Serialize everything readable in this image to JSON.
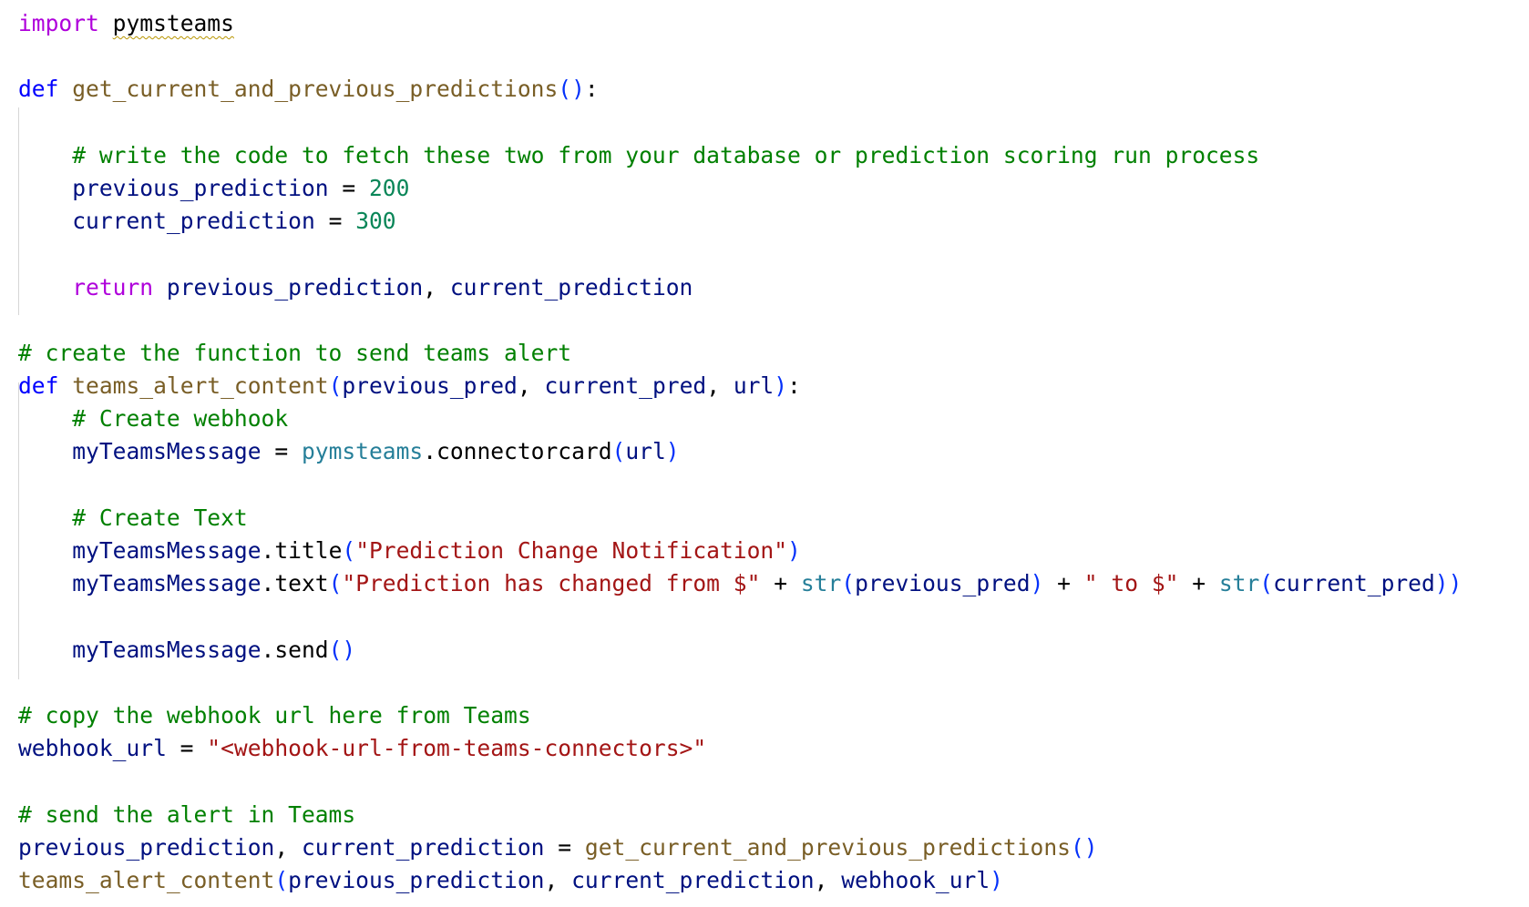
{
  "editor": {
    "language": "python",
    "lines": [
      [
        {
          "t": "import",
          "c": "keyword"
        },
        {
          "t": " ",
          "c": "plain"
        },
        {
          "t": "pymsteams",
          "c": "plain",
          "squiggle": true
        }
      ],
      [],
      [
        {
          "t": "def",
          "c": "def"
        },
        {
          "t": " ",
          "c": "plain"
        },
        {
          "t": "get_current_and_previous_predictions",
          "c": "func"
        },
        {
          "t": "()",
          "c": "paren"
        },
        {
          "t": ":",
          "c": "plain"
        }
      ],
      [],
      [
        {
          "t": "    ",
          "c": "plain"
        },
        {
          "t": "# write the code to fetch these two from your database or prediction scoring run process",
          "c": "comment"
        }
      ],
      [
        {
          "t": "    ",
          "c": "plain"
        },
        {
          "t": "previous_prediction",
          "c": "var"
        },
        {
          "t": " = ",
          "c": "plain"
        },
        {
          "t": "200",
          "c": "number"
        }
      ],
      [
        {
          "t": "    ",
          "c": "plain"
        },
        {
          "t": "current_prediction",
          "c": "var"
        },
        {
          "t": " = ",
          "c": "plain"
        },
        {
          "t": "300",
          "c": "number"
        }
      ],
      [],
      [
        {
          "t": "    ",
          "c": "plain"
        },
        {
          "t": "return",
          "c": "keyword"
        },
        {
          "t": " ",
          "c": "plain"
        },
        {
          "t": "previous_prediction",
          "c": "var"
        },
        {
          "t": ", ",
          "c": "plain"
        },
        {
          "t": "current_prediction",
          "c": "var"
        }
      ],
      [],
      [
        {
          "t": "# create the function to send teams alert",
          "c": "comment"
        }
      ],
      [
        {
          "t": "def",
          "c": "def"
        },
        {
          "t": " ",
          "c": "plain"
        },
        {
          "t": "teams_alert_content",
          "c": "func"
        },
        {
          "t": "(",
          "c": "paren"
        },
        {
          "t": "previous_pred",
          "c": "var"
        },
        {
          "t": ", ",
          "c": "plain"
        },
        {
          "t": "current_pred",
          "c": "var"
        },
        {
          "t": ", ",
          "c": "plain"
        },
        {
          "t": "url",
          "c": "var"
        },
        {
          "t": ")",
          "c": "paren"
        },
        {
          "t": ":",
          "c": "plain"
        }
      ],
      [
        {
          "t": "    ",
          "c": "plain"
        },
        {
          "t": "# Create webhook",
          "c": "comment"
        }
      ],
      [
        {
          "t": "    ",
          "c": "plain"
        },
        {
          "t": "myTeamsMessage",
          "c": "var"
        },
        {
          "t": " = ",
          "c": "plain"
        },
        {
          "t": "pymsteams",
          "c": "module"
        },
        {
          "t": ".connectorcard",
          "c": "plain"
        },
        {
          "t": "(",
          "c": "paren"
        },
        {
          "t": "url",
          "c": "var"
        },
        {
          "t": ")",
          "c": "paren"
        }
      ],
      [],
      [
        {
          "t": "    ",
          "c": "plain"
        },
        {
          "t": "# Create Text",
          "c": "comment"
        }
      ],
      [
        {
          "t": "    ",
          "c": "plain"
        },
        {
          "t": "myTeamsMessage",
          "c": "var"
        },
        {
          "t": ".title",
          "c": "plain"
        },
        {
          "t": "(",
          "c": "paren"
        },
        {
          "t": "\"Prediction Change Notification\"",
          "c": "string"
        },
        {
          "t": ")",
          "c": "paren"
        }
      ],
      [
        {
          "t": "    ",
          "c": "plain"
        },
        {
          "t": "myTeamsMessage",
          "c": "var"
        },
        {
          "t": ".text",
          "c": "plain"
        },
        {
          "t": "(",
          "c": "paren"
        },
        {
          "t": "\"Prediction has changed from $\"",
          "c": "string"
        },
        {
          "t": " + ",
          "c": "plain"
        },
        {
          "t": "str",
          "c": "builtin"
        },
        {
          "t": "(",
          "c": "paren"
        },
        {
          "t": "previous_pred",
          "c": "var"
        },
        {
          "t": ")",
          "c": "paren"
        },
        {
          "t": " + ",
          "c": "plain"
        },
        {
          "t": "\" to $\"",
          "c": "string"
        },
        {
          "t": " + ",
          "c": "plain"
        },
        {
          "t": "str",
          "c": "builtin"
        },
        {
          "t": "(",
          "c": "paren"
        },
        {
          "t": "current_pred",
          "c": "var"
        },
        {
          "t": "))",
          "c": "paren"
        }
      ],
      [],
      [
        {
          "t": "    ",
          "c": "plain"
        },
        {
          "t": "myTeamsMessage",
          "c": "var"
        },
        {
          "t": ".send",
          "c": "plain"
        },
        {
          "t": "()",
          "c": "paren"
        }
      ],
      [],
      [
        {
          "t": "# copy the webhook url here from Teams",
          "c": "comment"
        }
      ],
      [
        {
          "t": "webhook_url",
          "c": "var"
        },
        {
          "t": " = ",
          "c": "plain"
        },
        {
          "t": "\"<webhook-url-from-teams-connectors>\"",
          "c": "string"
        }
      ],
      [],
      [
        {
          "t": "# send the alert in Teams",
          "c": "comment"
        }
      ],
      [
        {
          "t": "previous_prediction",
          "c": "var"
        },
        {
          "t": ", ",
          "c": "plain"
        },
        {
          "t": "current_prediction",
          "c": "var"
        },
        {
          "t": " = ",
          "c": "plain"
        },
        {
          "t": "get_current_and_previous_predictions",
          "c": "func"
        },
        {
          "t": "()",
          "c": "paren"
        }
      ],
      [
        {
          "t": "teams_alert_content",
          "c": "func"
        },
        {
          "t": "(",
          "c": "paren"
        },
        {
          "t": "previous_prediction",
          "c": "var"
        },
        {
          "t": ", ",
          "c": "plain"
        },
        {
          "t": "current_prediction",
          "c": "var"
        },
        {
          "t": ", ",
          "c": "plain"
        },
        {
          "t": "webhook_url",
          "c": "var"
        },
        {
          "t": ")",
          "c": "paren"
        }
      ]
    ],
    "colors": {
      "keyword": "#af00db",
      "def": "#0000ff",
      "func": "#795e26",
      "comment": "#008000",
      "var": "#001080",
      "number": "#098658",
      "string": "#a31515",
      "builtin": "#267f99",
      "module": "#267f99",
      "plain": "#000000",
      "paren": "#0431fa",
      "indent_guide": "#d6d6d6",
      "warning_squiggle": "#b89500"
    }
  }
}
